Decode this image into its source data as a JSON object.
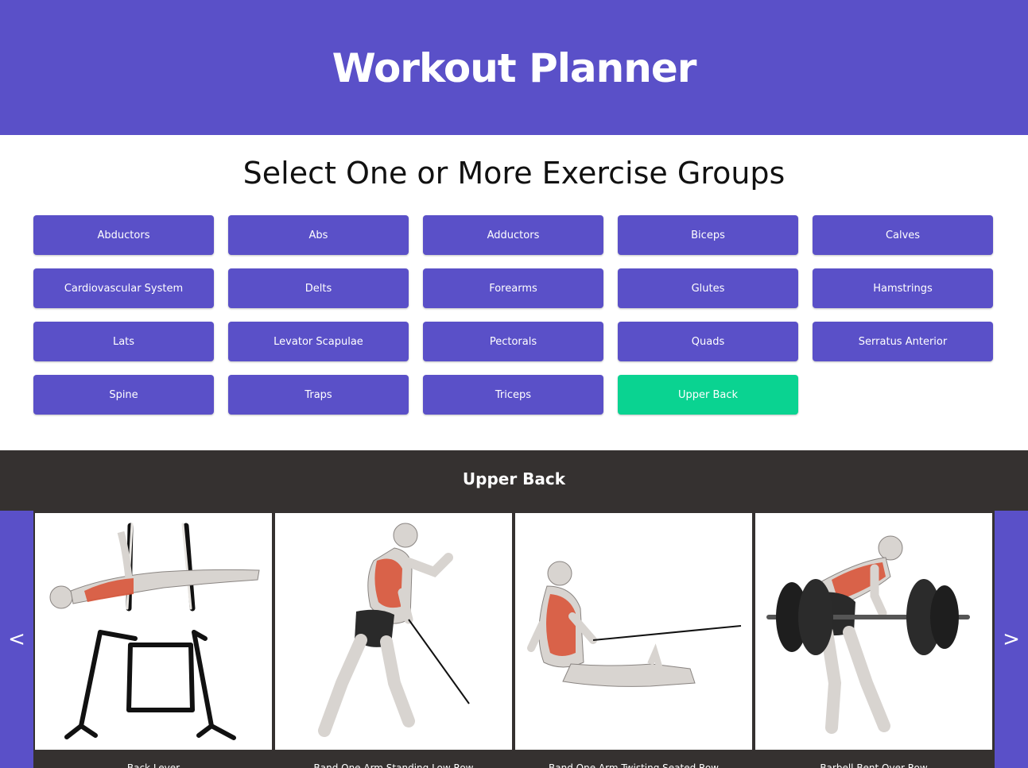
{
  "header": {
    "title": "Workout Planner"
  },
  "groups_section": {
    "subtitle": "Select One or More Exercise Groups",
    "groups": [
      {
        "label": "Abductors",
        "selected": false
      },
      {
        "label": "Abs",
        "selected": false
      },
      {
        "label": "Adductors",
        "selected": false
      },
      {
        "label": "Biceps",
        "selected": false
      },
      {
        "label": "Calves",
        "selected": false
      },
      {
        "label": "Cardiovascular System",
        "selected": false
      },
      {
        "label": "Delts",
        "selected": false
      },
      {
        "label": "Forearms",
        "selected": false
      },
      {
        "label": "Glutes",
        "selected": false
      },
      {
        "label": "Hamstrings",
        "selected": false
      },
      {
        "label": "Lats",
        "selected": false
      },
      {
        "label": "Levator Scapulae",
        "selected": false
      },
      {
        "label": "Pectorals",
        "selected": false
      },
      {
        "label": "Quads",
        "selected": false
      },
      {
        "label": "Serratus Anterior",
        "selected": false
      },
      {
        "label": "Spine",
        "selected": false
      },
      {
        "label": "Traps",
        "selected": false
      },
      {
        "label": "Triceps",
        "selected": false
      },
      {
        "label": "Upper Back",
        "selected": true
      }
    ]
  },
  "results": {
    "title": "Upper Back",
    "prev_label": "<",
    "next_label": ">",
    "cards": [
      {
        "caption": "Back Lever",
        "icon": "back-lever-illustration"
      },
      {
        "caption": "Band One Arm Standing Low Row",
        "icon": "band-standing-row-illustration"
      },
      {
        "caption": "Band One Arm Twisting Seated Row",
        "icon": "band-seated-row-illustration"
      },
      {
        "caption": "Barbell Bent Over Row",
        "icon": "barbell-row-illustration"
      }
    ]
  },
  "colors": {
    "primary": "#5a50c8",
    "selected": "#0ad391",
    "dark": "#353130",
    "muscle": "#d9553a"
  }
}
